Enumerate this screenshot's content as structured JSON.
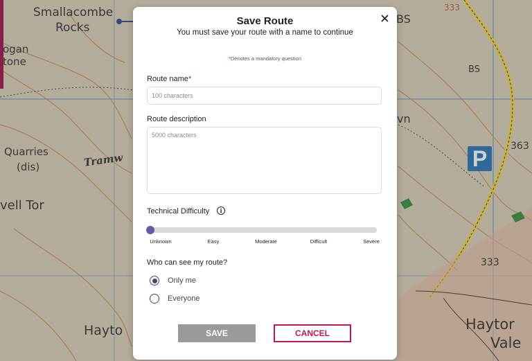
{
  "map": {
    "labels": {
      "smallacombe": "Smallacombe",
      "rocks": "Rocks",
      "ogan": "ogan",
      "tone": "tone",
      "quarries": "Quarries",
      "dis": "(dis)",
      "tramway": "Tramw",
      "vell_tor": "vell Tor",
      "hayto": "Hayto",
      "bs_top": "BS",
      "bs_right": "BS",
      "vn": "vn",
      "height_363": "363",
      "height_333": "333",
      "height_333_top": "333",
      "haytor": "Haytor",
      "vale": "Vale",
      "parking": "P"
    },
    "colors": {
      "background": "#d8cdb6",
      "contour": "#c98a5a",
      "grid": "#4a8fcf",
      "road": "#f0d23a",
      "accent_strip": "#8b1d4a"
    }
  },
  "modal": {
    "title": "Save Route",
    "subtitle": "You must save your route with a name to continue",
    "mandatory_asterisk": "*",
    "mandatory_note": "Denotes a mandatory question",
    "close_icon": "close-icon",
    "route_name": {
      "label": "Route name",
      "required_mark": "*",
      "placeholder": "100 characters",
      "value": ""
    },
    "route_description": {
      "label": "Route description",
      "placeholder": "5000 characters",
      "value": ""
    },
    "difficulty": {
      "label": "Technical Difficulty",
      "info_icon": "info-icon",
      "levels": [
        "Unknown",
        "Easy",
        "Moderate",
        "Difficult",
        "Severe"
      ],
      "selected": "Unknown",
      "selected_index": 0
    },
    "visibility": {
      "label": "Who can see my route?",
      "options": [
        "Only me",
        "Everyone"
      ],
      "selected": "Only me"
    },
    "buttons": {
      "save": "SAVE",
      "cancel": "CANCEL"
    },
    "colors": {
      "accent": "#c0174e",
      "slider_thumb": "#6a5aa9",
      "radio": "#4a3f7a",
      "save_bg": "#9a9a9a"
    }
  }
}
